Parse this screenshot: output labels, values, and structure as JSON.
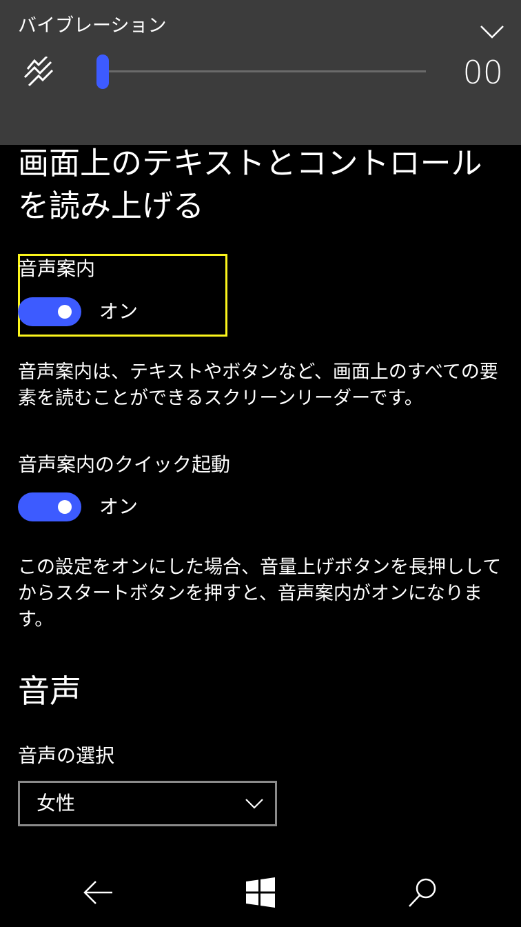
{
  "flyout": {
    "title": "バイブレーション",
    "value_text": "00",
    "slider_level_percent": 0,
    "accent_color": "#3d5bff",
    "icons": {
      "vibration": "vibration-icon",
      "collapse": "chevron-down-icon"
    }
  },
  "page": {
    "heading": "画面上のテキストとコントロールを読み上げる"
  },
  "narrator": {
    "label": "音声案内",
    "toggle_on": true,
    "state_text": "オン",
    "description": "音声案内は、テキストやボタンなど、画面上のすべての要素を読むことができるスクリーンリーダーです。"
  },
  "quick_launch": {
    "label": "音声案内のクイック起動",
    "toggle_on": true,
    "state_text": "オン",
    "description": "この設定をオンにした場合、音量上げボタンを長押ししてからスタートボタンを押すと、音声案内がオンになります。"
  },
  "voice": {
    "section_heading": "音声",
    "select_label": "音声の選択",
    "selected_value": "女性"
  },
  "focus_highlight_color": "#fbf51c",
  "navbar": {
    "icons": [
      "back-arrow-icon",
      "windows-start-icon",
      "search-icon"
    ]
  }
}
